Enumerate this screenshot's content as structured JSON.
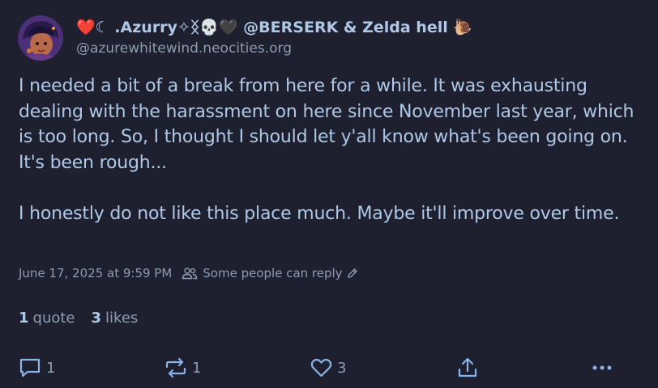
{
  "author": {
    "display_name_prefix": "❤️☾ .Azurry✧ᛝ💀🖤 @BERSERK & Zelda hell",
    "display_name_emoji": "🐌",
    "handle": "@azurewhitewind.neocities.org"
  },
  "post": {
    "paragraphs": [
      "I needed a bit of a break from here for a while. It was exhausting dealing with the harassment on here since November last year, which is too long. So, I thought I should let y'all know what's been going on. It's been rough...",
      "I honestly do not like this place much. Maybe it'll improve over time."
    ],
    "timestamp": "June 17, 2025 at 9:59 PM",
    "reply_setting": "Some people can reply"
  },
  "stats": {
    "quotes_count": "1",
    "quotes_label": "quote",
    "likes_count": "3",
    "likes_label": "likes"
  },
  "actions": {
    "reply_count": "1",
    "repost_count": "1",
    "like_count": "3"
  },
  "colors": {
    "background": "#1e2030",
    "text": "#aec8e6",
    "muted": "#8e9cb0"
  }
}
